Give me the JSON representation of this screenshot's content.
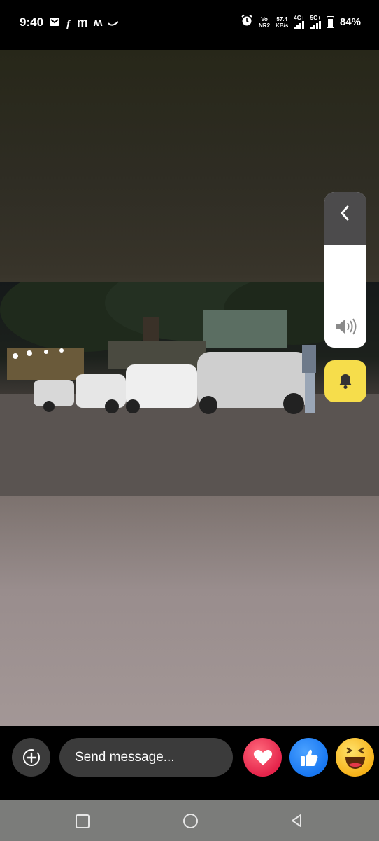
{
  "status_bar": {
    "time": "9:40",
    "left_icons": [
      "gmail-icon",
      "facebook-icon",
      "m-icon",
      "m-icon",
      "nike-icon"
    ],
    "network_left_top": "Vo",
    "network_left_bottom": "NR2",
    "speed_value": "57.4",
    "speed_unit": "KB/s",
    "sim1_label": "4G+",
    "sim2_label": "5G+",
    "battery": "84%"
  },
  "story": {
    "photo_description_icon": "photo-icon",
    "volume_level": 0.66,
    "volume_icon": "speaker-icon",
    "collapse_icon": "chevron-left-icon",
    "bell_icon": "bell-icon",
    "bell_color": "#f6dd4b"
  },
  "bottom_bar": {
    "add_icon": "add-circle-icon",
    "message_placeholder": "Send message...",
    "reactions": [
      "heart-icon",
      "like-icon",
      "haha-icon"
    ]
  },
  "nav_bar": {
    "buttons": [
      "recents-icon",
      "home-icon",
      "back-icon"
    ]
  }
}
